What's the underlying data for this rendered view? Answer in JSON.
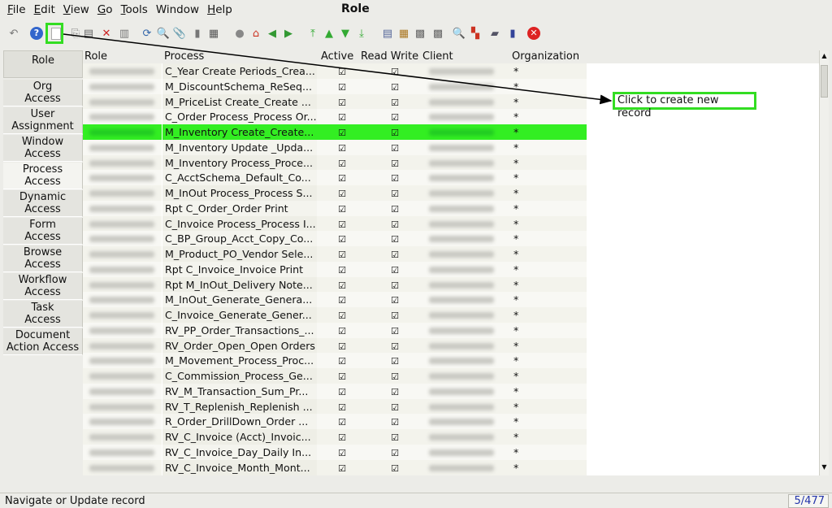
{
  "menubar": [
    {
      "pre": "",
      "u": "F",
      "post": "ile"
    },
    {
      "pre": "",
      "u": "E",
      "post": "dit"
    },
    {
      "pre": "",
      "u": "V",
      "post": "iew"
    },
    {
      "pre": "",
      "u": "G",
      "post": "o"
    },
    {
      "pre": "",
      "u": "T",
      "post": "ools"
    },
    {
      "pre": "",
      "u": "",
      "post": "Window"
    },
    {
      "pre": "",
      "u": "H",
      "post": "elp"
    }
  ],
  "window_title": "Role",
  "left_tabs": [
    {
      "label": "Role",
      "selected": false
    },
    {
      "label": "Org\nAccess",
      "selected": false
    },
    {
      "label": "User\nAssignment",
      "selected": false
    },
    {
      "label": "Window\nAccess",
      "selected": false
    },
    {
      "label": "Process\nAccess",
      "selected": true
    },
    {
      "label": "Dynamic\nAccess",
      "selected": false
    },
    {
      "label": "Form\nAccess",
      "selected": false
    },
    {
      "label": "Browse\nAccess",
      "selected": false
    },
    {
      "label": "Workflow\nAccess",
      "selected": false
    },
    {
      "label": "Task\nAccess",
      "selected": false
    },
    {
      "label": "Document\nAction Access",
      "selected": false
    }
  ],
  "grid": {
    "columns": [
      "Role",
      "Process",
      "Active",
      "Read Write",
      "Client",
      "Organization"
    ],
    "selected_row_color": "#33ee22",
    "rows": [
      {
        "process": "C_Year Create Periods_Crea...",
        "active": true,
        "rw": true,
        "org": "*"
      },
      {
        "process": "M_DiscountSchema_ReSeq...",
        "active": true,
        "rw": true,
        "org": "*"
      },
      {
        "process": "M_PriceList Create_Create ...",
        "active": true,
        "rw": true,
        "org": "*"
      },
      {
        "process": "C_Order Process_Process Or...",
        "active": true,
        "rw": true,
        "org": "*"
      },
      {
        "process": "M_Inventory Create_Create...",
        "active": true,
        "rw": true,
        "org": "*",
        "selected": true
      },
      {
        "process": "M_Inventory Update _Upda...",
        "active": true,
        "rw": true,
        "org": "*"
      },
      {
        "process": "M_Inventory Process_Proce...",
        "active": true,
        "rw": true,
        "org": "*"
      },
      {
        "process": "C_AcctSchema_Default_Co...",
        "active": true,
        "rw": true,
        "org": "*"
      },
      {
        "process": "M_InOut Process_Process S...",
        "active": true,
        "rw": true,
        "org": "*"
      },
      {
        "process": "Rpt C_Order_Order Print",
        "active": true,
        "rw": true,
        "org": "*"
      },
      {
        "process": "C_Invoice Process_Process I...",
        "active": true,
        "rw": true,
        "org": "*"
      },
      {
        "process": "C_BP_Group_Acct_Copy_Co...",
        "active": true,
        "rw": true,
        "org": "*"
      },
      {
        "process": "M_Product_PO_Vendor Sele...",
        "active": true,
        "rw": true,
        "org": "*"
      },
      {
        "process": "Rpt C_Invoice_Invoice Print",
        "active": true,
        "rw": true,
        "org": "*"
      },
      {
        "process": "Rpt M_InOut_Delivery Note...",
        "active": true,
        "rw": true,
        "org": "*"
      },
      {
        "process": "M_InOut_Generate_Genera...",
        "active": true,
        "rw": true,
        "org": "*"
      },
      {
        "process": "C_Invoice_Generate_Gener...",
        "active": true,
        "rw": true,
        "org": "*"
      },
      {
        "process": "RV_PP_Order_Transactions_...",
        "active": true,
        "rw": true,
        "org": "*"
      },
      {
        "process": "RV_Order_Open_Open Orders",
        "active": true,
        "rw": true,
        "org": "*"
      },
      {
        "process": "M_Movement_Process_Proc...",
        "active": true,
        "rw": true,
        "org": "*"
      },
      {
        "process": "C_Commission_Process_Ge...",
        "active": true,
        "rw": true,
        "org": "*"
      },
      {
        "process": "RV_M_Transaction_Sum_Pr...",
        "active": true,
        "rw": true,
        "org": "*"
      },
      {
        "process": "RV_T_Replenish_Replenish ...",
        "active": true,
        "rw": true,
        "org": "*"
      },
      {
        "process": "R_Order_DrillDown_Order ...",
        "active": true,
        "rw": true,
        "org": "*"
      },
      {
        "process": "RV_C_Invoice (Acct)_Invoic...",
        "active": true,
        "rw": true,
        "org": "*"
      },
      {
        "process": "RV_C_Invoice_Day_Daily In...",
        "active": true,
        "rw": true,
        "org": "*"
      },
      {
        "process": "RV_C_Invoice_Month_Mont...",
        "active": true,
        "rw": true,
        "org": "*"
      }
    ]
  },
  "callout": {
    "text": "Click to create new record",
    "color": "#33dd22"
  },
  "status": {
    "text": "Navigate or Update record",
    "count": "5/477"
  },
  "toolbar_icons": [
    "undo-icon",
    "help-icon",
    "new-record-icon",
    "copy-record-icon",
    "save-icon",
    "delete-icon",
    "grid-toggle-icon",
    "refresh-icon",
    "find-icon",
    "attachment-icon",
    "chat-icon",
    "multi-view-icon",
    "history-icon",
    "home-icon",
    "back-icon",
    "forward-icon",
    "first-icon",
    "previous-icon",
    "next-icon",
    "last-icon",
    "report-icon",
    "archive-icon",
    "print-preview-icon",
    "print-icon",
    "zoom-across-icon",
    "request-icon",
    "workflow-icon",
    "product-info-icon",
    "exit-icon"
  ]
}
